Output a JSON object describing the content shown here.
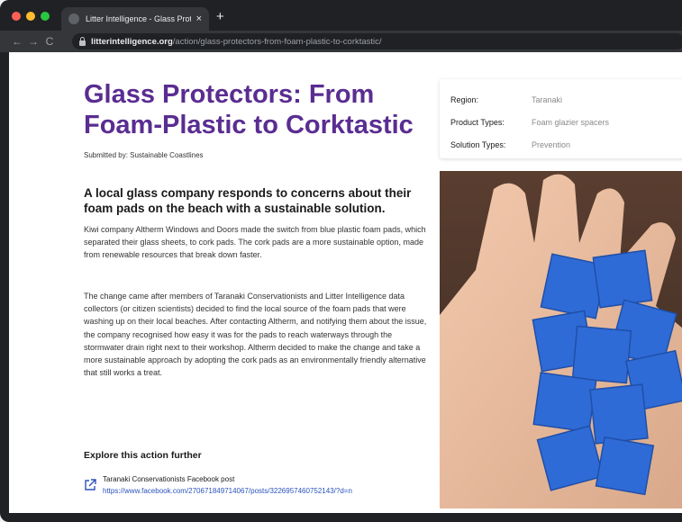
{
  "browser": {
    "tab_title": "Litter Intelligence - Glass Prote",
    "tab_close": "×",
    "new_tab": "+",
    "url_host": "litterintelligence.org",
    "url_path": "/action/glass-protectors-from-foam-plastic-to-corktastic/",
    "back": "←",
    "forward": "→",
    "reload": "C"
  },
  "article": {
    "title": "Glass Protectors: From Foam-Plastic to Corktastic",
    "submitted_by": "Submitted by: Sustainable Coastlines",
    "subtitle": "A local glass company responds to concerns about their foam pads on the beach with a sustainable solution.",
    "paragraphs": [
      "Kiwi company Altherm Windows and Doors made the switch from blue plastic foam pads, which separated their glass sheets, to cork pads. The cork pads are a more sustainable option, made from renewable resources that break down faster.",
      "The change came after members of Taranaki Conservationists and Litter Intelligence data collectors (or citizen scientists) decided to find the local source of the foam pads that were washing up on their local beaches. After contacting Altherm, and notifying them about the issue, the company recognised how easy it was for the pads to reach waterways through the stormwater drain right next to their workshop. Altherm decided to make the change and take a more sustainable approach by adopting the cork pads as an environmentally friendly alternative that still works a treat."
    ],
    "explore_heading": "Explore this action further",
    "link_label": "Taranaki Conservationists Facebook post",
    "link_url": "https://www.facebook.com/270671849714067/posts/3226957460752143/?d=n"
  },
  "info": {
    "rows": [
      {
        "key": "Region:",
        "value": "Taranaki"
      },
      {
        "key": "Product Types:",
        "value": "Foam glazier spacers"
      },
      {
        "key": "Solution Types:",
        "value": "Prevention"
      }
    ]
  },
  "colors": {
    "title": "#5a2d91",
    "link": "#2a52be",
    "foam_pad": "#2f6bd6"
  },
  "icons": {
    "external_link": "external-link-icon",
    "lock": "lock-icon"
  }
}
